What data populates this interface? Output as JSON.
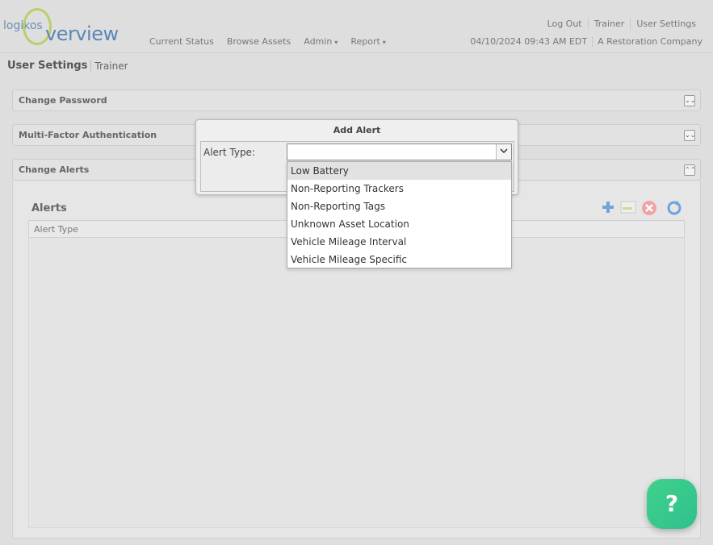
{
  "logo": {
    "small": "logikos",
    "big": "verview"
  },
  "nav": {
    "items": [
      {
        "label": "Current Status"
      },
      {
        "label": "Browse Assets"
      },
      {
        "label": "Admin",
        "caret": "▾"
      },
      {
        "label": "Report",
        "caret": "▾"
      }
    ]
  },
  "toplinks": {
    "logout": "Log Out",
    "user": "Trainer",
    "settings": "User Settings"
  },
  "header": {
    "datetime": "04/10/2024 09:43 AM EDT",
    "company": "A Restoration Company"
  },
  "breadcrumb": {
    "main": "User Settings",
    "sub": "Trainer"
  },
  "panels": {
    "change_password": {
      "title": "Change Password",
      "toggle": "⌄⌄"
    },
    "mfa": {
      "title": "Multi-Factor Authentication",
      "toggle": "⌄⌄"
    },
    "change_alerts": {
      "title": "Change Alerts",
      "toggle": "⌃⌃"
    }
  },
  "alerts": {
    "title": "Alerts",
    "columns": [
      "Alert Type"
    ],
    "toolbar_icons": [
      "add-icon",
      "edit-icon",
      "delete-icon",
      "refresh-icon"
    ]
  },
  "dialog": {
    "title": "Add Alert",
    "field_label": "Alert Type:",
    "field_value": "",
    "options": [
      "Low Battery",
      "Non-Reporting Trackers",
      "Non-Reporting Tags",
      "Unknown Asset Location",
      "Vehicle Mileage Interval",
      "Vehicle Mileage Specific"
    ],
    "highlighted_index": 0
  },
  "help": {
    "label": "?"
  },
  "colors": {
    "accent_green": "#3fd28a",
    "logo_blue": "#5a87b8",
    "logo_ring": "#b8d06a"
  }
}
